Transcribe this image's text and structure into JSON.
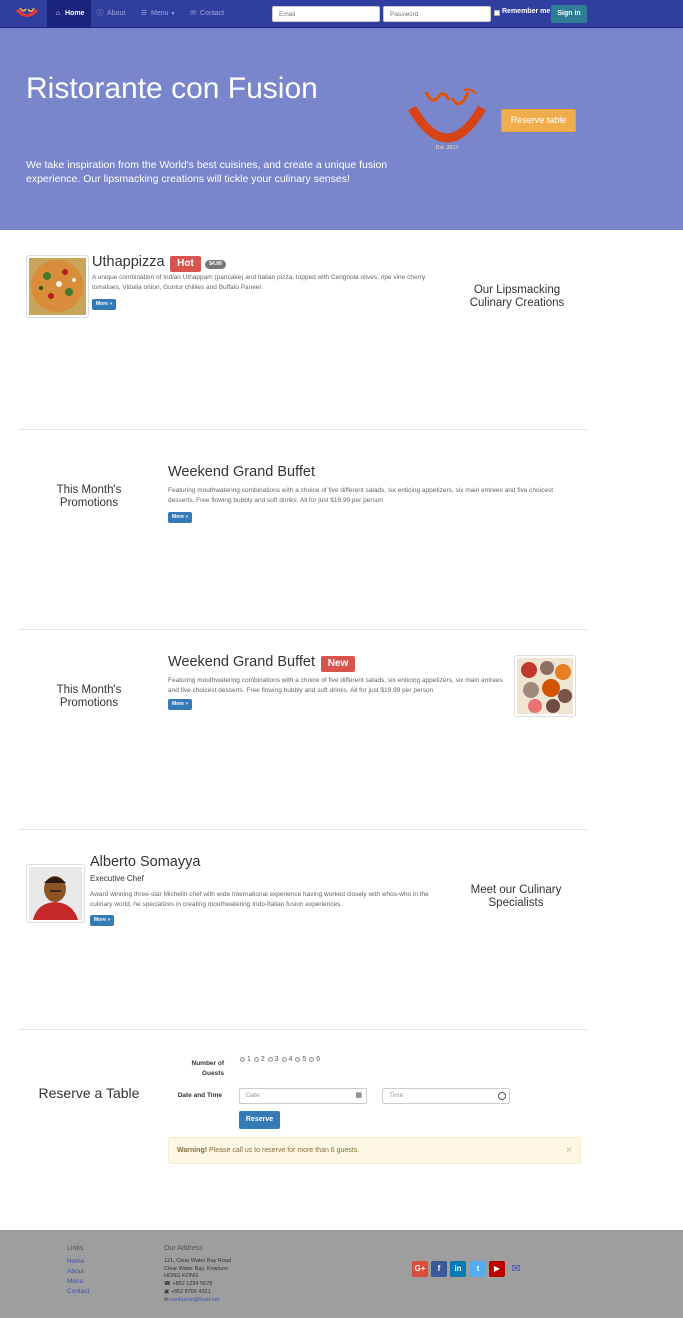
{
  "nav": {
    "items": [
      {
        "label": "Home",
        "icon": "home-icon"
      },
      {
        "label": "About",
        "icon": "info-icon"
      },
      {
        "label": "Menu",
        "icon": "list-icon"
      },
      {
        "label": "Contact",
        "icon": "envelope-icon"
      }
    ],
    "email_placeholder": "Email",
    "password_placeholder": "Password",
    "remember_label": "Remember me",
    "signin_label": "Sign in"
  },
  "jumbotron": {
    "title": "Ristorante con Fusion",
    "subtitle": "We take inspiration from the World's best cuisines, and create a unique fusion experience. Our lipsmacking creations will tickle your culinary senses!",
    "reserve_label": "Reserve table",
    "logo_text": "Ristorante con Fusion",
    "logo_est": "Est. 2013"
  },
  "dish": {
    "title": "Uthappizza",
    "label": "Hot",
    "price": "$4.99",
    "description": "A unique combination of Indian Uthappam (pancake) and Italian pizza, topped with Cerignola olives, ripe vine cherry tomatoes, Vidalia onion, Guntur chillies and Buffalo Paneer.",
    "more_label": "More »",
    "side_heading": "Our Lipsmacking Culinary Creations"
  },
  "promotion1": {
    "side_heading": "This Month's Promotions",
    "title": "Weekend Grand Buffet",
    "description": "Featuring mouthwatering combinations with a choice of five different salads, six enticing appetizers, six main entrees and five choicest desserts. Free flowing bubbly and soft drinks. All for just $19.99 per person",
    "more_label": "More »"
  },
  "promotion2": {
    "side_heading": "This Month's Promotions",
    "title": "Weekend Grand Buffet",
    "label": "New",
    "description": "Featuring mouthwatering combinations with a choice of five different salads, six enticing appetizers, six main entrees and five choicest desserts. Free flowing bubbly and soft drinks. All for just $19.99 per person",
    "more_label": "More »"
  },
  "chef": {
    "name": "Alberto Somayya",
    "role": "Executive Chef",
    "description": "Award winning three-star Michelin chef with wide International experience having worked closely with whos-who in the culinary world, he specializes in creating mouthwatering Indo-Italian fusion experiences.",
    "more_label": "More »",
    "side_heading": "Meet our Culinary Specialists"
  },
  "reserve": {
    "heading": "Reserve a Table",
    "guests_label": "Number of Guests",
    "guest_options": [
      "1",
      "2",
      "3",
      "4",
      "5",
      "6"
    ],
    "datetime_label": "Date and Time",
    "date_placeholder": "Date",
    "time_placeholder": "Time",
    "submit_label": "Reserve",
    "warning_strong": "Warning!",
    "warning_text": " Please call us to reserve for more than 6 guests.",
    "close_symbol": "×"
  },
  "footer": {
    "links_heading": "Links",
    "links": [
      "Home",
      "About",
      "Menu",
      "Contact"
    ],
    "address_heading": "Our Address",
    "address_lines": [
      "121, Clear Water Bay Road",
      "Clear Water Bay, Kowloon",
      "HONG KONG"
    ],
    "phone": "+852 1234 5678",
    "fax": "+852 8765 4321",
    "email": "confusion@food.net",
    "social": [
      {
        "label": "G+",
        "color": "#dd4b39",
        "icon": "google-plus-icon"
      },
      {
        "label": "f",
        "color": "#3b5998",
        "icon": "facebook-icon"
      },
      {
        "label": "in",
        "color": "#007bb5",
        "icon": "linkedin-icon"
      },
      {
        "label": "t",
        "color": "#55acee",
        "icon": "twitter-icon"
      },
      {
        "label": "▶",
        "color": "#bb0000",
        "icon": "youtube-icon"
      }
    ]
  },
  "colors": {
    "navbar": "#303f9f",
    "jumbotron": "#7986cb",
    "accent_orange": "#f0ad4e",
    "primary_blue": "#337ab7",
    "footer": "#9e9e9e"
  }
}
